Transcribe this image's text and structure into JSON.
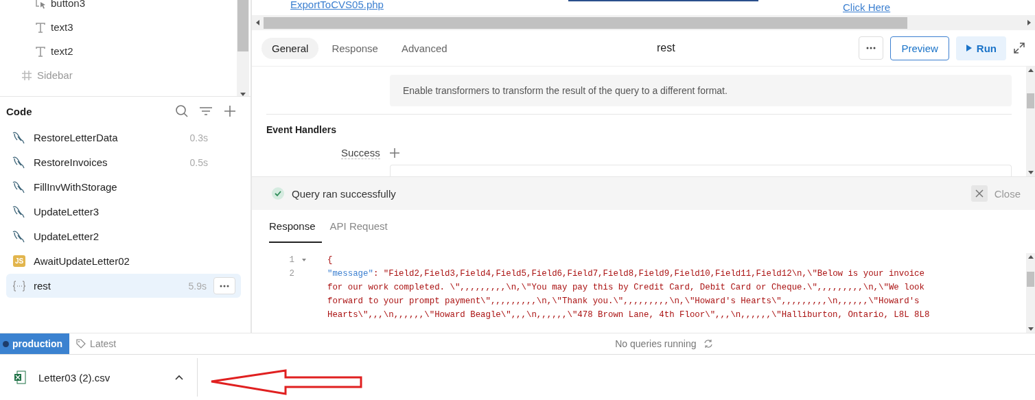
{
  "tree": [
    {
      "label": "button3",
      "kind": "button"
    },
    {
      "label": "text3",
      "kind": "text"
    },
    {
      "label": "text2",
      "kind": "text"
    },
    {
      "label": "Sidebar",
      "kind": "frame"
    }
  ],
  "code_panel": {
    "title": "Code",
    "items": [
      {
        "name": "RestoreLetterData",
        "kind": "sql",
        "time": "0.3s",
        "selected": false
      },
      {
        "name": "RestoreInvoices",
        "kind": "sql",
        "time": "0.5s",
        "selected": false
      },
      {
        "name": "FillInvWithStorage",
        "kind": "sql",
        "selected": false
      },
      {
        "name": "UpdateLetter3",
        "kind": "sql",
        "selected": false
      },
      {
        "name": "UpdateLetter2",
        "kind": "sql",
        "selected": false
      },
      {
        "name": "AwaitUpdateLetter02",
        "kind": "js",
        "badge": "JS",
        "selected": false
      },
      {
        "name": "rest",
        "kind": "rest",
        "time": "5.9s",
        "selected": true
      }
    ]
  },
  "preview": {
    "link": "ExportToCVS05.php",
    "link_2": "Click Here"
  },
  "editor": {
    "tabs": [
      {
        "label": "General",
        "selected": true
      },
      {
        "label": "Response",
        "selected": false
      },
      {
        "label": "Advanced",
        "selected": false
      }
    ],
    "title": "rest",
    "preview_button": "Preview",
    "run_button": "Run",
    "transformer_hint": "Enable transformers to transform the result of the query to a different format.",
    "event_handlers": "Event Handlers",
    "success_label": "Success"
  },
  "result": {
    "status": "Query ran successfully",
    "close": "Close",
    "tabs": [
      {
        "label": "Response",
        "selected": true
      },
      {
        "label": "API Request",
        "selected": false
      }
    ],
    "code": [
      {
        "number": "1",
        "foldable": true,
        "lines": [
          {
            "text": "{"
          }
        ]
      },
      {
        "number": "2",
        "foldable": false,
        "key": "\"message\"",
        "lines": [
          {
            "text": ": \"Field2,Field3,Field4,Field5,Field6,Field7,Field8,Field9,Field10,Field11,Field12\\n,\\\"Below is your invoice"
          },
          {
            "text": "for our work completed. \\\",,,,,,,,,\\n,\\\"You may pay this by Credit Card, Debit Card or Cheque.\\\",,,,,,,,,\\n,\\\"We look"
          },
          {
            "text": "forward to your prompt payment\\\",,,,,,,,,\\n,\\\"Thank you.\\\",,,,,,,,,\\n,\\\"Howard's Hearts\\\",,,,,,,,,\\n,,,,,,\\\"Howard's"
          },
          {
            "text": "Hearts\\\",,,\\n,,,,,,\\\"Howard Beagle\\\",,,\\n,,,,,,\\\"478 Brown Lane, 4th Floor\\\",,,\\n,,,,,,\\\"Halliburton, Ontario, L8L 8L8"
          }
        ]
      }
    ]
  },
  "status_bar": {
    "environment": "production",
    "version": "Latest",
    "queries": "No queries running"
  },
  "downloads": [
    {
      "file": "Letter03 (2).csv"
    }
  ]
}
